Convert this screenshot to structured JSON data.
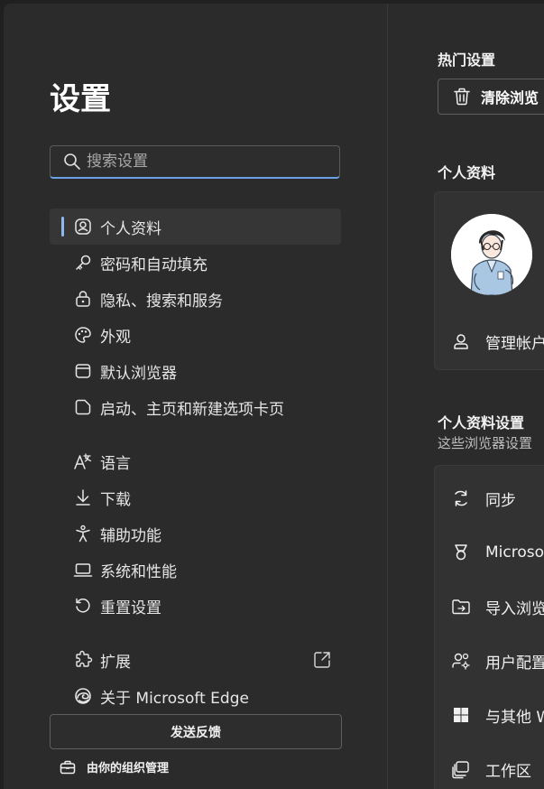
{
  "sidebar": {
    "title": "设置",
    "search_placeholder": "搜索设置",
    "items": [
      {
        "label": "个人资料",
        "icon": "profile-icon",
        "active": true
      },
      {
        "label": "密码和自动填充",
        "icon": "key-icon"
      },
      {
        "label": "隐私、搜索和服务",
        "icon": "lock-icon"
      },
      {
        "label": "外观",
        "icon": "palette-icon"
      },
      {
        "label": "默认浏览器",
        "icon": "browser-icon"
      },
      {
        "label": "启动、主页和新建选项卡页",
        "icon": "new-tab-icon"
      },
      {
        "label": "语言",
        "icon": "language-icon"
      },
      {
        "label": "下载",
        "icon": "download-icon"
      },
      {
        "label": "辅助功能",
        "icon": "accessibility-icon"
      },
      {
        "label": "系统和性能",
        "icon": "laptop-icon"
      },
      {
        "label": "重置设置",
        "icon": "reset-icon"
      },
      {
        "label": "扩展",
        "icon": "puzzle-icon"
      },
      {
        "label": "关于 Microsoft Edge",
        "icon": "edge-icon"
      }
    ],
    "feedback_label": "发送反馈",
    "org_label": "由你的组织管理"
  },
  "main": {
    "popular_heading": "热门设置",
    "clear_label": "清除浏览",
    "profile_heading": "个人资料",
    "manage_label": "管理帐户",
    "profile_settings_heading": "个人资料设置",
    "profile_settings_sub": "这些浏览器设置",
    "settings_rows": [
      {
        "label": "同步",
        "icon": "sync-icon"
      },
      {
        "label": "Microso",
        "icon": "rewards-icon"
      },
      {
        "label": "导入浏览",
        "icon": "import-icon"
      },
      {
        "label": "用户配置",
        "icon": "user-settings-icon"
      },
      {
        "label": "与其他 W",
        "icon": "windows-icon"
      },
      {
        "label": "工作区",
        "icon": "workspaces-icon"
      }
    ]
  },
  "colors": {
    "accent": "#8fb8ee",
    "background": "#2b2b2b"
  }
}
